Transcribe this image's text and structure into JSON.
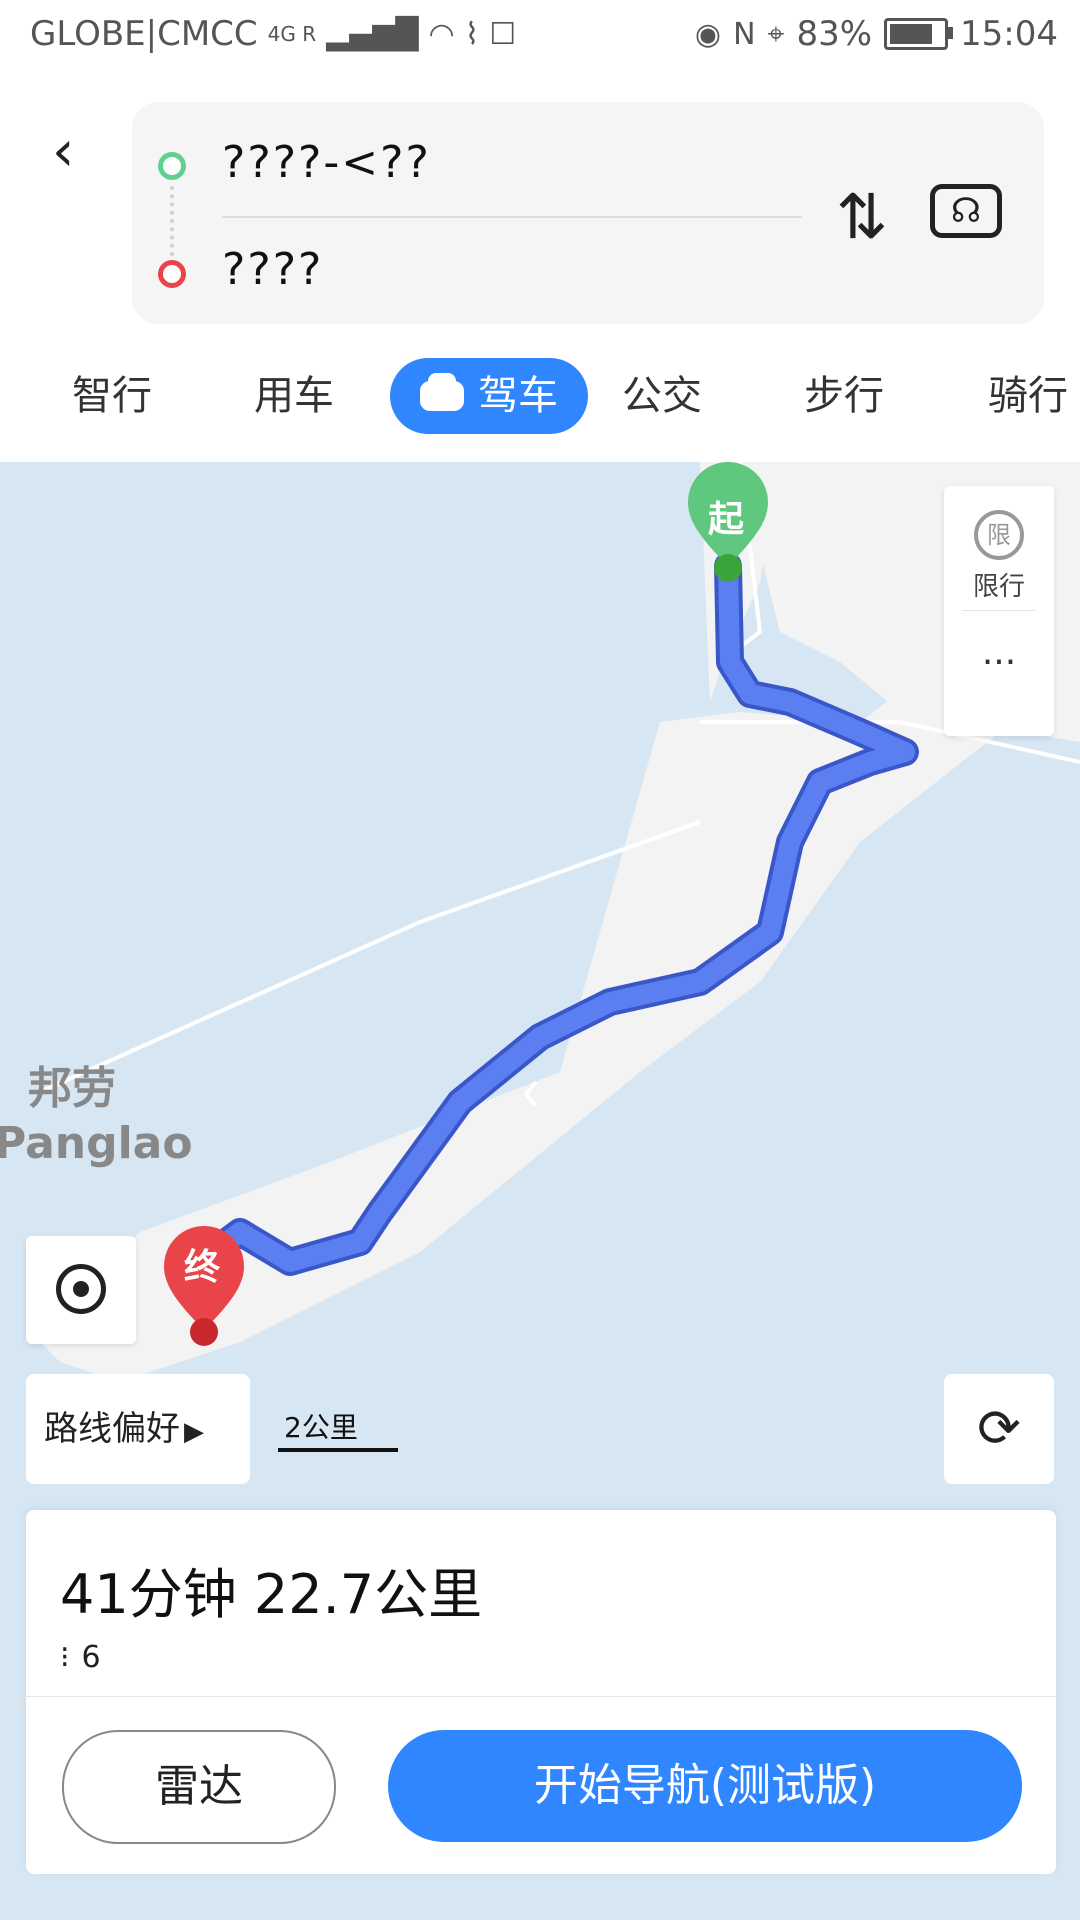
{
  "status_bar": {
    "carrier": "GLOBE|CMCC",
    "network": "4G R",
    "battery_percent": "83%",
    "time": "15:04"
  },
  "route": {
    "from": "????-<??",
    "to": "????"
  },
  "tabs": [
    {
      "label": "智行"
    },
    {
      "label": "用车"
    },
    {
      "label": "驾车",
      "active": true
    },
    {
      "label": "公交"
    },
    {
      "label": "步行"
    },
    {
      "label": "骑行"
    }
  ],
  "map": {
    "start_marker": "起",
    "end_marker": "终",
    "place_name_cn": "邦劳",
    "place_name_en": "Panglao",
    "limit_icon_text": "限",
    "limit_label": "限行",
    "more": "...",
    "route_preference": "路线偏好",
    "scale_label": "2公里"
  },
  "summary": {
    "duration_distance": "41分钟  22.7公里",
    "traffic_lights": "6"
  },
  "buttons": {
    "radar": "雷达",
    "start_navigation": "开始导航(测试版)"
  },
  "colors": {
    "accent": "#2f86ff",
    "route_line": "#5b7ef0",
    "start_marker": "#5fc77e",
    "end_marker": "#e8444a",
    "water": "#d7e6f3",
    "land": "#f3f3f3"
  }
}
